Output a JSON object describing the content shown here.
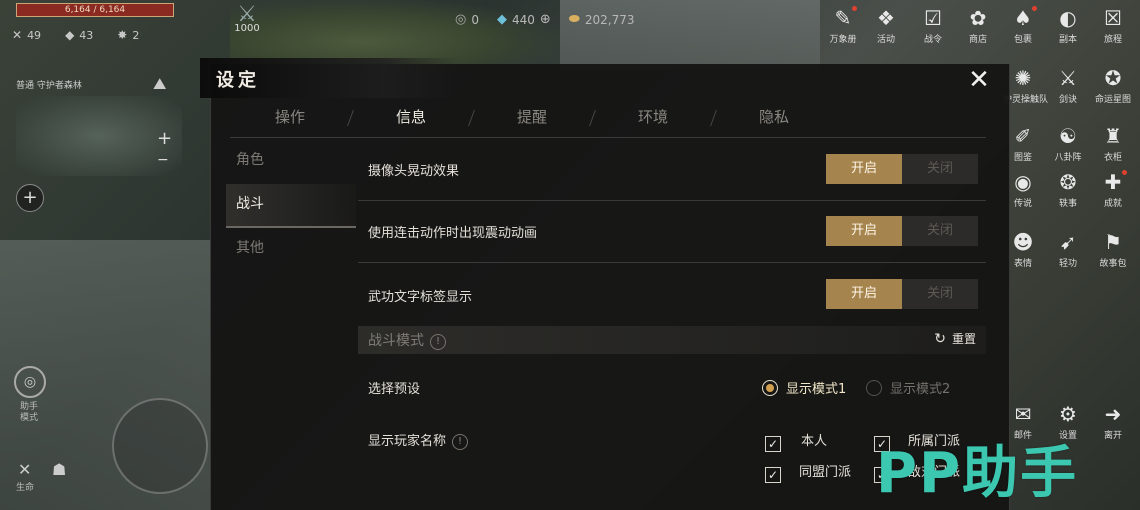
{
  "hud": {
    "hp_text": "6,164 / 6,164",
    "stats": [
      {
        "icon": "crossed-swords-icon",
        "glyph": "✕",
        "value": "49"
      },
      {
        "icon": "shield-icon",
        "glyph": "◆",
        "value": "43"
      },
      {
        "icon": "spark-icon",
        "glyph": "✸",
        "value": "2"
      }
    ],
    "level": "1000",
    "currencies": [
      {
        "icon": "ring-icon",
        "glyph": "◎",
        "value": "0"
      },
      {
        "icon": "jade-icon",
        "glyph": "◆",
        "value": "440"
      },
      {
        "icon": "gold-ingot-icon",
        "glyph": "⬬",
        "value": "202,773"
      }
    ],
    "map_label": "普通 守护者森林"
  },
  "right_menu": [
    {
      "label": "万象册",
      "glyph": "✎",
      "dot": true
    },
    {
      "label": "活动",
      "glyph": "❖",
      "dot": false
    },
    {
      "label": "战令",
      "glyph": "☑",
      "dot": false
    },
    {
      "label": "商店",
      "glyph": "✿",
      "dot": false
    },
    {
      "label": "包裹",
      "glyph": "♠",
      "dot": true
    },
    {
      "label": "副本",
      "glyph": "◐",
      "dot": false
    },
    {
      "label": "旅程",
      "glyph": "☒",
      "dot": false
    },
    {
      "label": "护灵操触队",
      "glyph": "✺",
      "dot": false
    },
    {
      "label": "剑诀",
      "glyph": "⚔",
      "dot": false
    },
    {
      "label": "命运星图",
      "glyph": "✪",
      "dot": false
    },
    {
      "label": "图鉴",
      "glyph": "✐",
      "dot": false
    },
    {
      "label": "八卦阵",
      "glyph": "☯",
      "dot": false
    },
    {
      "label": "衣柜",
      "glyph": "♜",
      "dot": false
    },
    {
      "label": "传说",
      "glyph": "◉",
      "dot": false
    },
    {
      "label": "轶事",
      "glyph": "❂",
      "dot": false
    },
    {
      "label": "成就",
      "glyph": "✚",
      "dot": true
    },
    {
      "label": "表情",
      "glyph": "☻",
      "dot": false
    },
    {
      "label": "轻功",
      "glyph": "➹",
      "dot": false
    },
    {
      "label": "故事包",
      "glyph": "⚑",
      "dot": false
    },
    {
      "label": "邮件",
      "glyph": "✉",
      "dot": false
    },
    {
      "label": "设置",
      "glyph": "⚙",
      "dot": false
    },
    {
      "label": "离开",
      "glyph": "➜",
      "dot": false
    }
  ],
  "assist": {
    "label": "助手模式"
  },
  "bottom_left_label": "生命",
  "settings": {
    "title": "设定",
    "close_glyph": "✕",
    "tabs": [
      "操作",
      "信息",
      "提醒",
      "环境",
      "隐私"
    ],
    "active_tab": "信息",
    "side_items": [
      "角色",
      "战斗",
      "其他"
    ],
    "active_side": "战斗",
    "toggles": [
      {
        "label": "摄像头晃动效果",
        "on": "开启",
        "off": "关闭"
      },
      {
        "label": "使用连击动作时出现震动动画",
        "on": "开启",
        "off": "关闭"
      },
      {
        "label": "武功文字标签显示",
        "on": "开启",
        "off": "关闭"
      }
    ],
    "combat_mode": {
      "title": "战斗模式",
      "info": "!",
      "reset": "重置",
      "preset_label": "选择预设",
      "preset_options": [
        "显示模式1",
        "显示模式2"
      ],
      "name_label": "显示玩家名称",
      "name_options": [
        "本人",
        "所属门派",
        "同盟门派",
        "敌对门派"
      ]
    }
  },
  "watermark": "PP助手",
  "colors": {
    "accent": "#a5844e",
    "watermark": "#3cc8b0"
  }
}
